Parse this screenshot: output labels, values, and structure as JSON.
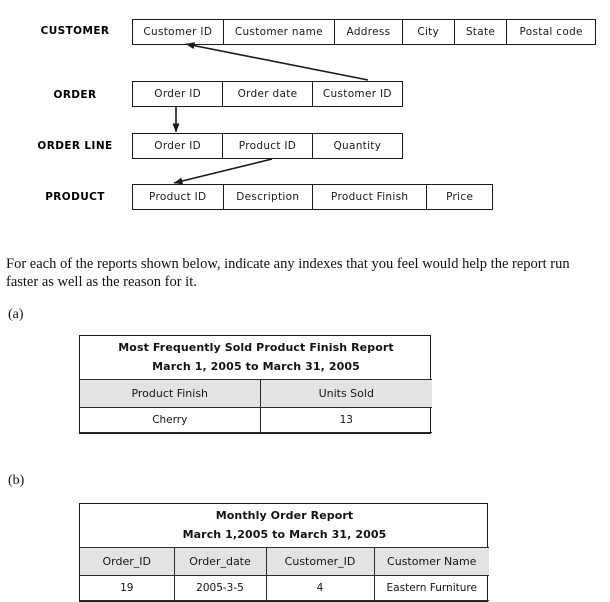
{
  "diagram": {
    "entities": [
      {
        "name": "CUSTOMER",
        "attributes": [
          "Customer ID",
          "Customer name",
          "Address",
          "City",
          "State",
          "Postal code"
        ]
      },
      {
        "name": "ORDER",
        "attributes": [
          "Order ID",
          "Order date",
          "Customer ID"
        ]
      },
      {
        "name": "ORDER LINE",
        "attributes": [
          "Order ID",
          "Product ID",
          "Quantity"
        ]
      },
      {
        "name": "PRODUCT",
        "attributes": [
          "Product ID",
          "Description",
          "Product Finish",
          "Price"
        ]
      }
    ],
    "relationships": [
      {
        "name": "order-to-customer",
        "from": "ORDER.Customer ID",
        "to": "CUSTOMER.Customer ID"
      },
      {
        "name": "order-to-order-line",
        "from": "ORDER.Order ID",
        "to": "ORDER LINE.Order ID"
      },
      {
        "name": "order-line-to-product",
        "from": "ORDER LINE.Product ID",
        "to": "PRODUCT.Product ID"
      }
    ]
  },
  "prompt": {
    "text": "For each of the reports shown below, indicate any indexes that you feel would help the report run faster as well as the reason for it."
  },
  "parts": [
    {
      "label": "(a)",
      "report": {
        "title_line1": "Most Frequently Sold Product Finish Report",
        "title_line2": "March 1, 2005 to March 31, 2005",
        "columns": [
          "Product Finish",
          "Units Sold"
        ],
        "rows": [
          [
            "Cherry",
            "13"
          ]
        ]
      }
    },
    {
      "label": "(b)",
      "report": {
        "title_line1": "Monthly Order Report",
        "title_line2": "March 1,2005 to March 31, 2005",
        "columns": [
          "Order_ID",
          "Order_date",
          "Customer_ID",
          "Customer Name"
        ],
        "rows": [
          [
            "19",
            "2005-3-5",
            "4",
            "Eastern Furniture"
          ]
        ]
      }
    }
  ],
  "colors": {
    "table_header_fill": "#e3e3e3",
    "border": "#1a1a1a",
    "text": "#111111",
    "page_background": "#ffffff"
  }
}
